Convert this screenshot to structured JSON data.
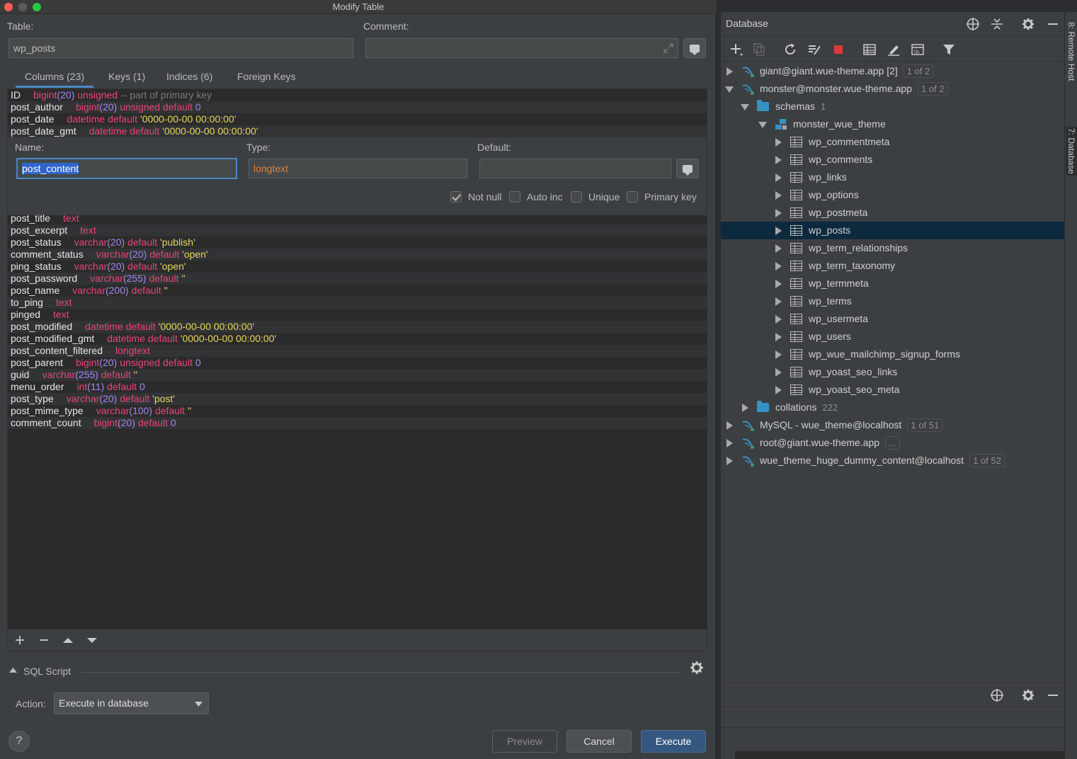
{
  "window": {
    "title": "Modify Table"
  },
  "table": {
    "label": "Table:",
    "value": "wp_posts"
  },
  "comment": {
    "label": "Comment:",
    "value": ""
  },
  "tabs": [
    {
      "label": "Columns (23)"
    },
    {
      "label": "Keys (1)"
    },
    {
      "label": "Indices (6)"
    },
    {
      "label": "Foreign Keys"
    }
  ],
  "columns_top": [
    {
      "name": "ID",
      "def": [
        [
          "kw",
          "bigint"
        ],
        [
          "num",
          "(20) "
        ],
        [
          "kw",
          "unsigned "
        ],
        [
          "cmt",
          "-- part of primary key"
        ]
      ]
    },
    {
      "name": "post_author",
      "def": [
        [
          "kw",
          "bigint"
        ],
        [
          "num",
          "(20) "
        ],
        [
          "kw",
          "unsigned default "
        ],
        [
          "num",
          "0"
        ]
      ]
    },
    {
      "name": "post_date",
      "def": [
        [
          "kw",
          "datetime default "
        ],
        [
          "str",
          "'0000-00-00 00:00:00'"
        ]
      ]
    },
    {
      "name": "post_date_gmt",
      "def": [
        [
          "kw",
          "datetime default "
        ],
        [
          "str",
          "'0000-00-00 00:00:00'"
        ]
      ]
    }
  ],
  "editor": {
    "name_label": "Name:",
    "name_value": "post_content",
    "type_label": "Type:",
    "type_value": "longtext",
    "default_label": "Default:",
    "default_value": "",
    "not_null": "Not null",
    "auto_inc": "Auto inc",
    "unique": "Unique",
    "primary_key": "Primary key"
  },
  "columns_bottom": [
    {
      "name": "post_title",
      "def": [
        [
          "kw",
          "text"
        ]
      ]
    },
    {
      "name": "post_excerpt",
      "def": [
        [
          "kw",
          "text"
        ]
      ]
    },
    {
      "name": "post_status",
      "def": [
        [
          "kw",
          "varchar"
        ],
        [
          "num",
          "(20) "
        ],
        [
          "kw",
          "default "
        ],
        [
          "str",
          "'publish'"
        ]
      ]
    },
    {
      "name": "comment_status",
      "def": [
        [
          "kw",
          "varchar"
        ],
        [
          "num",
          "(20) "
        ],
        [
          "kw",
          "default "
        ],
        [
          "str",
          "'open'"
        ]
      ]
    },
    {
      "name": "ping_status",
      "def": [
        [
          "kw",
          "varchar"
        ],
        [
          "num",
          "(20) "
        ],
        [
          "kw",
          "default "
        ],
        [
          "str",
          "'open'"
        ]
      ]
    },
    {
      "name": "post_password",
      "def": [
        [
          "kw",
          "varchar"
        ],
        [
          "num",
          "(255) "
        ],
        [
          "kw",
          "default "
        ],
        [
          "str",
          "''"
        ]
      ]
    },
    {
      "name": "post_name",
      "def": [
        [
          "kw",
          "varchar"
        ],
        [
          "num",
          "(200) "
        ],
        [
          "kw",
          "default "
        ],
        [
          "str",
          "''"
        ]
      ]
    },
    {
      "name": "to_ping",
      "def": [
        [
          "kw",
          "text"
        ]
      ]
    },
    {
      "name": "pinged",
      "def": [
        [
          "kw",
          "text"
        ]
      ]
    },
    {
      "name": "post_modified",
      "def": [
        [
          "kw",
          "datetime default "
        ],
        [
          "str",
          "'0000-00-00 00:00:00'"
        ]
      ]
    },
    {
      "name": "post_modified_gmt",
      "def": [
        [
          "kw",
          "datetime default "
        ],
        [
          "str",
          "'0000-00-00 00:00:00'"
        ]
      ]
    },
    {
      "name": "post_content_filtered",
      "def": [
        [
          "kw",
          "longtext"
        ]
      ]
    },
    {
      "name": "post_parent",
      "def": [
        [
          "kw",
          "bigint"
        ],
        [
          "num",
          "(20) "
        ],
        [
          "kw",
          "unsigned default "
        ],
        [
          "num",
          "0"
        ]
      ]
    },
    {
      "name": "guid",
      "def": [
        [
          "kw",
          "varchar"
        ],
        [
          "num",
          "(255) "
        ],
        [
          "kw",
          "default "
        ],
        [
          "str",
          "''"
        ]
      ]
    },
    {
      "name": "menu_order",
      "def": [
        [
          "kw",
          "int"
        ],
        [
          "num",
          "(11) "
        ],
        [
          "kw",
          "default "
        ],
        [
          "num",
          "0"
        ]
      ]
    },
    {
      "name": "post_type",
      "def": [
        [
          "kw",
          "varchar"
        ],
        [
          "num",
          "(20) "
        ],
        [
          "kw",
          "default "
        ],
        [
          "str",
          "'post'"
        ]
      ]
    },
    {
      "name": "post_mime_type",
      "def": [
        [
          "kw",
          "varchar"
        ],
        [
          "num",
          "(100) "
        ],
        [
          "kw",
          "default "
        ],
        [
          "str",
          "''"
        ]
      ]
    },
    {
      "name": "comment_count",
      "def": [
        [
          "kw",
          "bigint"
        ],
        [
          "num",
          "(20) "
        ],
        [
          "kw",
          "default "
        ],
        [
          "num",
          "0"
        ]
      ]
    }
  ],
  "sql_script": {
    "label": "SQL Script",
    "action_label": "Action:",
    "action_value": "Execute in database"
  },
  "buttons": {
    "help": "?",
    "preview": "Preview",
    "cancel": "Cancel",
    "execute": "Execute"
  },
  "db": {
    "title": "Database",
    "tree": [
      {
        "text": "giant@giant.wue-theme.app [2]",
        "badge": "1 of 2",
        "kind": "ds",
        "level": 0,
        "open": false
      },
      {
        "text": "monster@monster.wue-theme.app",
        "badge": "1 of 2",
        "kind": "ds",
        "level": 0,
        "open": true
      },
      {
        "text": "schemas",
        "count": "1",
        "kind": "folder",
        "level": 1,
        "open": true
      },
      {
        "text": "monster_wue_theme",
        "kind": "schema",
        "level": 2,
        "open": true
      },
      {
        "text": "wp_commentmeta",
        "kind": "table",
        "level": 3
      },
      {
        "text": "wp_comments",
        "kind": "table",
        "level": 3
      },
      {
        "text": "wp_links",
        "kind": "table",
        "level": 3
      },
      {
        "text": "wp_options",
        "kind": "table",
        "level": 3
      },
      {
        "text": "wp_postmeta",
        "kind": "table",
        "level": 3
      },
      {
        "text": "wp_posts",
        "kind": "table",
        "level": 3,
        "selected": true
      },
      {
        "text": "wp_term_relationships",
        "kind": "table",
        "level": 3
      },
      {
        "text": "wp_term_taxonomy",
        "kind": "table",
        "level": 3
      },
      {
        "text": "wp_termmeta",
        "kind": "table",
        "level": 3
      },
      {
        "text": "wp_terms",
        "kind": "table",
        "level": 3
      },
      {
        "text": "wp_usermeta",
        "kind": "table",
        "level": 3
      },
      {
        "text": "wp_users",
        "kind": "table",
        "level": 3
      },
      {
        "text": "wp_wue_mailchimp_signup_forms",
        "kind": "table",
        "level": 3
      },
      {
        "text": "wp_yoast_seo_links",
        "kind": "table",
        "level": 3
      },
      {
        "text": "wp_yoast_seo_meta",
        "kind": "table",
        "level": 3
      },
      {
        "text": "collations",
        "count": "222",
        "kind": "folder",
        "level": 1,
        "open": false
      },
      {
        "text": "MySQL - wue_theme@localhost",
        "badge": "1 of 51",
        "kind": "ds",
        "level": 0,
        "open": false
      },
      {
        "text": "root@giant.wue-theme.app",
        "badge": "...",
        "kind": "ds",
        "level": 0,
        "open": false
      },
      {
        "text": "wue_theme_huge_dummy_content@localhost",
        "badge": "1 of 52",
        "kind": "ds",
        "level": 0,
        "open": false
      }
    ]
  },
  "sidebar": {
    "remote_host": "8: Remote Host",
    "database": "7: Database"
  }
}
